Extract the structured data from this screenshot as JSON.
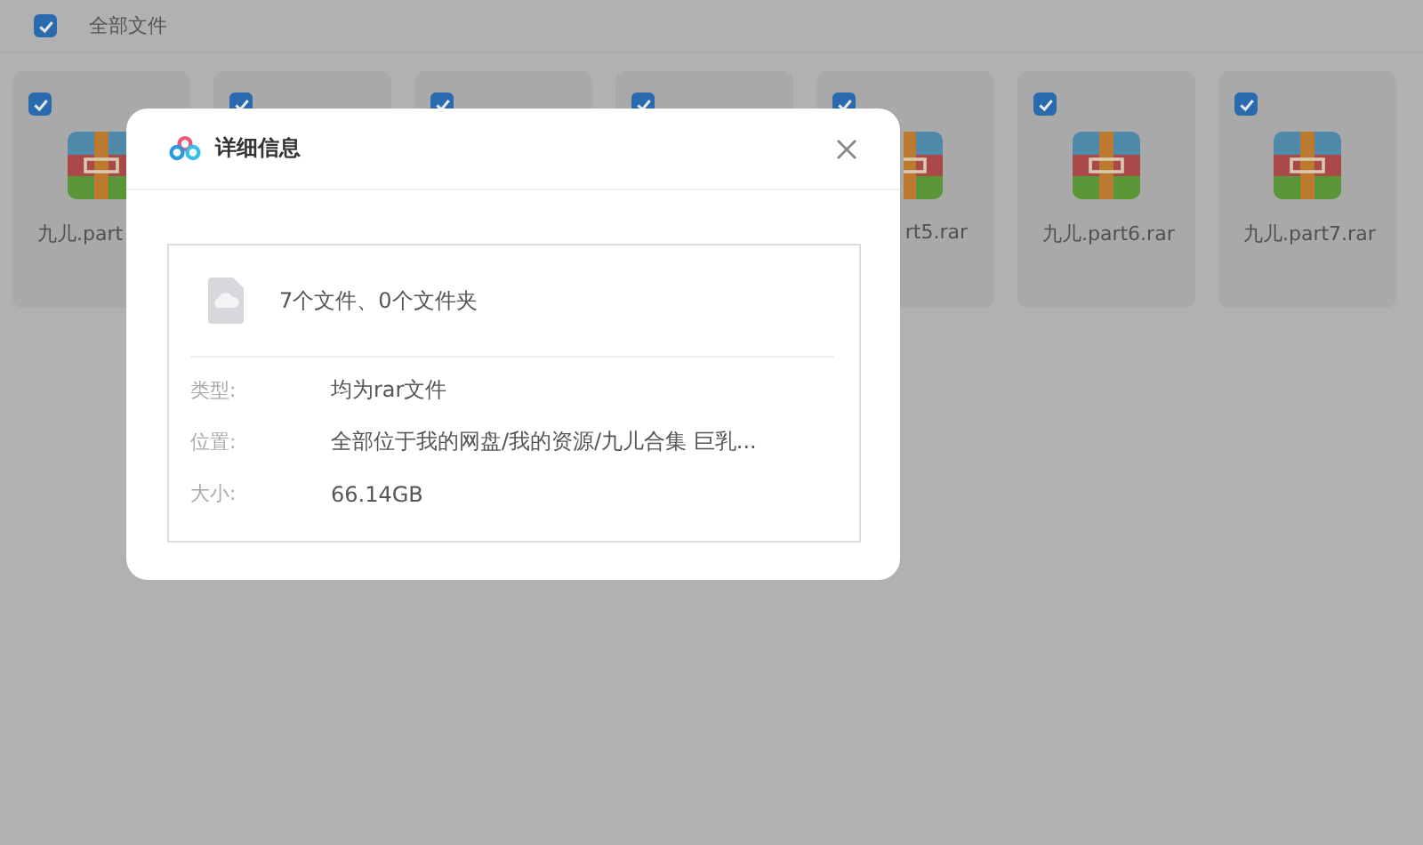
{
  "header": {
    "checked": true,
    "label": "全部文件"
  },
  "files": [
    {
      "kind": "head",
      "checked": true,
      "name": "九儿.part"
    },
    {
      "kind": "covered",
      "checked": true
    },
    {
      "kind": "covered",
      "checked": true
    },
    {
      "kind": "covered",
      "checked": true
    },
    {
      "kind": "tail",
      "checked": true,
      "name": "rt5.rar"
    },
    {
      "kind": "whole",
      "checked": true,
      "name": "九儿.part6.rar"
    },
    {
      "kind": "whole",
      "checked": true,
      "name": "九儿.part7.rar"
    }
  ],
  "dialog": {
    "title": "详细信息",
    "summary": "7个文件、0个文件夹",
    "rows": [
      {
        "label": "类型:",
        "value": "均为rar文件"
      },
      {
        "label": "位置:",
        "value": "全部位于我的网盘/我的资源/九儿合集 巨乳..."
      },
      {
        "label": "大小:",
        "value": "66.14GB"
      }
    ]
  }
}
